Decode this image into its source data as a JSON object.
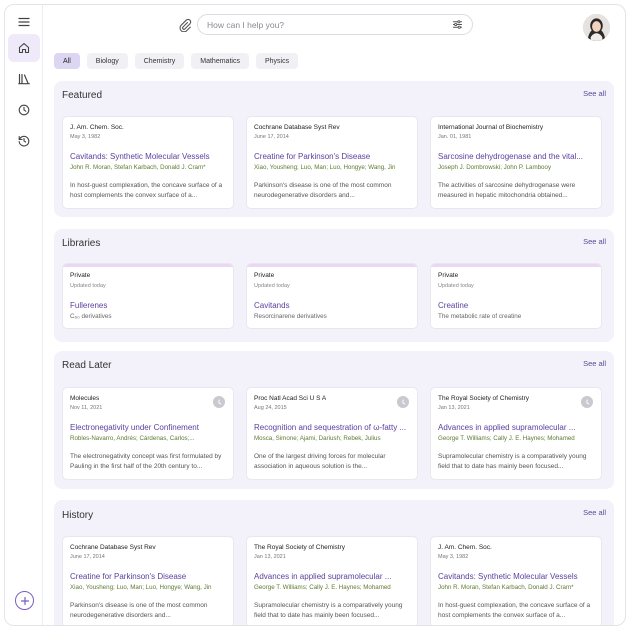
{
  "search": {
    "placeholder": "How can I help you?"
  },
  "filters": [
    "All",
    "Biology",
    "Chemistry",
    "Mathematics",
    "Physics"
  ],
  "sections": {
    "featured": {
      "title": "Featured",
      "see_all": "See all",
      "cards": [
        {
          "journal": "J. Am. Chem. Soc.",
          "date": "May 3, 1982",
          "title": "Cavitands: Synthetic Molecular Vessels",
          "authors": "John R. Moran, Stefan Karbach, Donald J. Cram*",
          "abstract": "In host-guest complexation, the concave surface of a host complements the convex surface of a..."
        },
        {
          "journal": "Cochrane Database Syst Rev",
          "date": "June 17, 2014",
          "title": "Creatine for Parkinson's Disease",
          "authors": "Xiao, Yousheng; Luo, Man; Luo, Hongye; Wang, Jin",
          "abstract": "Parkinson's disease is one of the most common neurodegenerative disorders and..."
        },
        {
          "journal": "International Journal of Biochemistry",
          "date": "Jan. 01, 1981",
          "title": "Sarcosine dehydrogenase and the vital...",
          "authors": "Joseph J. Dombrowski; John P. Lambooy",
          "abstract": "The activities of sarcosine dehydrogenase were measured in hepatic mitochondria obtained..."
        }
      ]
    },
    "libraries": {
      "title": "Libraries",
      "see_all": "See all",
      "cards": [
        {
          "privacy": "Private",
          "updated": "Updated today",
          "name": "Fullerenes",
          "desc": "C₆₀ derivatives"
        },
        {
          "privacy": "Private",
          "updated": "Updated today",
          "name": "Cavitands",
          "desc": "Resorcinarene derivatives"
        },
        {
          "privacy": "Private",
          "updated": "Updated today",
          "name": "Creatine",
          "desc": "The metabolic rate of creatine"
        }
      ]
    },
    "read_later": {
      "title": "Read Later",
      "see_all": "See all",
      "cards": [
        {
          "journal": "Molecules",
          "date": "Nov 11, 2021",
          "title": "Electronegativity under Confinement",
          "authors": "Robles-Navarro, Andrés; Cárdenas, Carlos;...",
          "abstract": "The electronegativity concept was first formulated by Pauling in the first half of the 20th century to..."
        },
        {
          "journal": "Proc Natl Acad Sci U S A",
          "date": "Aug 24, 2015",
          "title": "Recognition and sequestration of ω-fatty ...",
          "authors": "Mosca, Simone; Ajami, Dariush; Rebek, Julius",
          "abstract": "One of the largest driving forces for molecular association in aqueous solution is the..."
        },
        {
          "journal": "The Royal Society of Chemistry",
          "date": "Jan 13, 2021",
          "title": "Advances in applied supramolecular ...",
          "authors": "George T. Williams; Cally J. E. Haynes; Mohamed",
          "abstract": "Supramolecular chemistry is a comparatively young field that to date has mainly been focused..."
        }
      ]
    },
    "history": {
      "title": "History",
      "see_all": "See all",
      "cards": [
        {
          "journal": "Cochrane Database Syst Rev",
          "date": "June 17, 2014",
          "title": "Creatine for Parkinson's Disease",
          "authors": "Xiao, Yousheng; Luo, Man; Luo, Hongye; Wang, Jin",
          "abstract": "Parkinson's disease is one of the most common neurodegenerative disorders and..."
        },
        {
          "journal": "The Royal Society of Chemistry",
          "date": "Jan 13, 2021",
          "title": "Advances in applied supramolecular ...",
          "authors": "George T. Williams; Cally J. E. Haynes; Mohamed",
          "abstract": "Supramolecular chemistry is a comparatively young field that to date has mainly been focused..."
        },
        {
          "journal": "J. Am. Chem. Soc.",
          "date": "May 3, 1982",
          "title": "Cavitands: Synthetic Molecular Vessels",
          "authors": "John R. Moran, Stefan Karbach, Donald J. Cram*",
          "abstract": "In host-guest complexation, the concave surface of a host complements the convex surface of a..."
        }
      ]
    }
  },
  "colors": {
    "accent": "#5b3f9d",
    "authors": "#5e7a32",
    "section_bg": "#f3f2fb",
    "active_chip": "#dcd6f3"
  },
  "icons": [
    "menu-icon",
    "home-icon",
    "library-icon",
    "clock-icon",
    "history-icon",
    "add-icon",
    "paperclip-icon",
    "sliders-icon"
  ]
}
